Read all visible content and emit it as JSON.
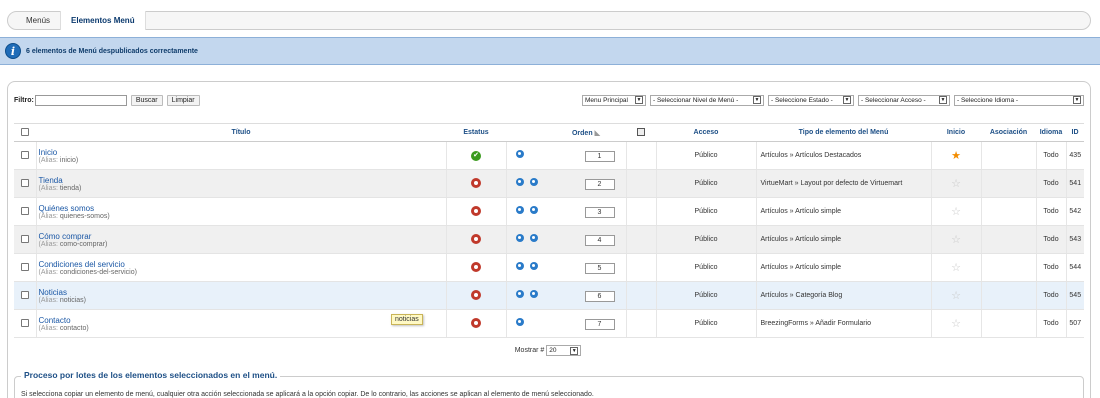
{
  "submenu": {
    "tabs": [
      "Menús",
      "Elementos Menú"
    ]
  },
  "message": {
    "text": "6 elementos de Menú despublicados correctamente"
  },
  "filter": {
    "label": "Filtro:",
    "input_value": "",
    "search_button": "Buscar",
    "clear_button": "Limpiar",
    "menu_select": "Menu Principal",
    "level_select": "- Seleccionar Nivel de Menú -",
    "state_select": "- Seleccione Estado -",
    "access_select": "- Seleccionar Acceso -",
    "language_select": "- Seleccione Idioma -"
  },
  "table": {
    "headers": {
      "title": "Título",
      "status": "Estatus",
      "order": "Orden",
      "access": "Acceso",
      "type": "Tipo de elemento del Menú",
      "home": "Inicio",
      "association": "Asociación",
      "language": "Idioma",
      "id": "ID"
    },
    "alias_label": "(Alias:",
    "rows": [
      {
        "title": "Inicio",
        "alias": "inicio)",
        "published": true,
        "order": "1",
        "access": "Público",
        "type": "Artículos » Artículos Destacados",
        "home": true,
        "language": "Todo",
        "id": "435"
      },
      {
        "title": "Tienda",
        "alias": "tienda)",
        "published": false,
        "order": "2",
        "access": "Público",
        "type": "VirtueMart » Layout por defecto de Virtuemart",
        "home": false,
        "language": "Todo",
        "id": "541"
      },
      {
        "title": "Quiénes somos",
        "alias": "quienes-somos)",
        "published": false,
        "order": "3",
        "access": "Público",
        "type": "Artículos » Artículo simple",
        "home": false,
        "language": "Todo",
        "id": "542"
      },
      {
        "title": "Cómo comprar",
        "alias": "como-comprar)",
        "published": false,
        "order": "4",
        "access": "Público",
        "type": "Artículos » Artículo simple",
        "home": false,
        "language": "Todo",
        "id": "543"
      },
      {
        "title": "Condiciones del servicio",
        "alias": "condiciones-del-servicio)",
        "published": false,
        "order": "5",
        "access": "Público",
        "type": "Artículos » Artículo simple",
        "home": false,
        "language": "Todo",
        "id": "544"
      },
      {
        "title": "Noticias",
        "alias": "noticias)",
        "published": false,
        "order": "6",
        "access": "Público",
        "type": "Artículos » Categoría Blog",
        "home": false,
        "language": "Todo",
        "id": "545"
      },
      {
        "title": "Contacto",
        "alias": "contacto)",
        "published": false,
        "order": "7",
        "access": "Público",
        "type": "BreezingForms » Añadir Formulario",
        "home": false,
        "language": "Todo",
        "id": "507"
      }
    ]
  },
  "tooltip": "noticias",
  "pager": {
    "label": "Mostrar #",
    "value": "20"
  },
  "batch": {
    "legend": "Proceso por lotes de los elementos seleccionados en el menú.",
    "description": "Si selecciona copiar un elemento de menú, cualquier otra acción seleccionada se aplicará a la opción copiar. De lo contrario, las acciones se aplican al elemento de menú seleccionado."
  },
  "colors": {
    "accent": "#1d4f86",
    "message_bg": "#c3d7ee",
    "published": "#3a9a1e",
    "unpublished": "#c0392b",
    "home_star": "#f28c00"
  }
}
